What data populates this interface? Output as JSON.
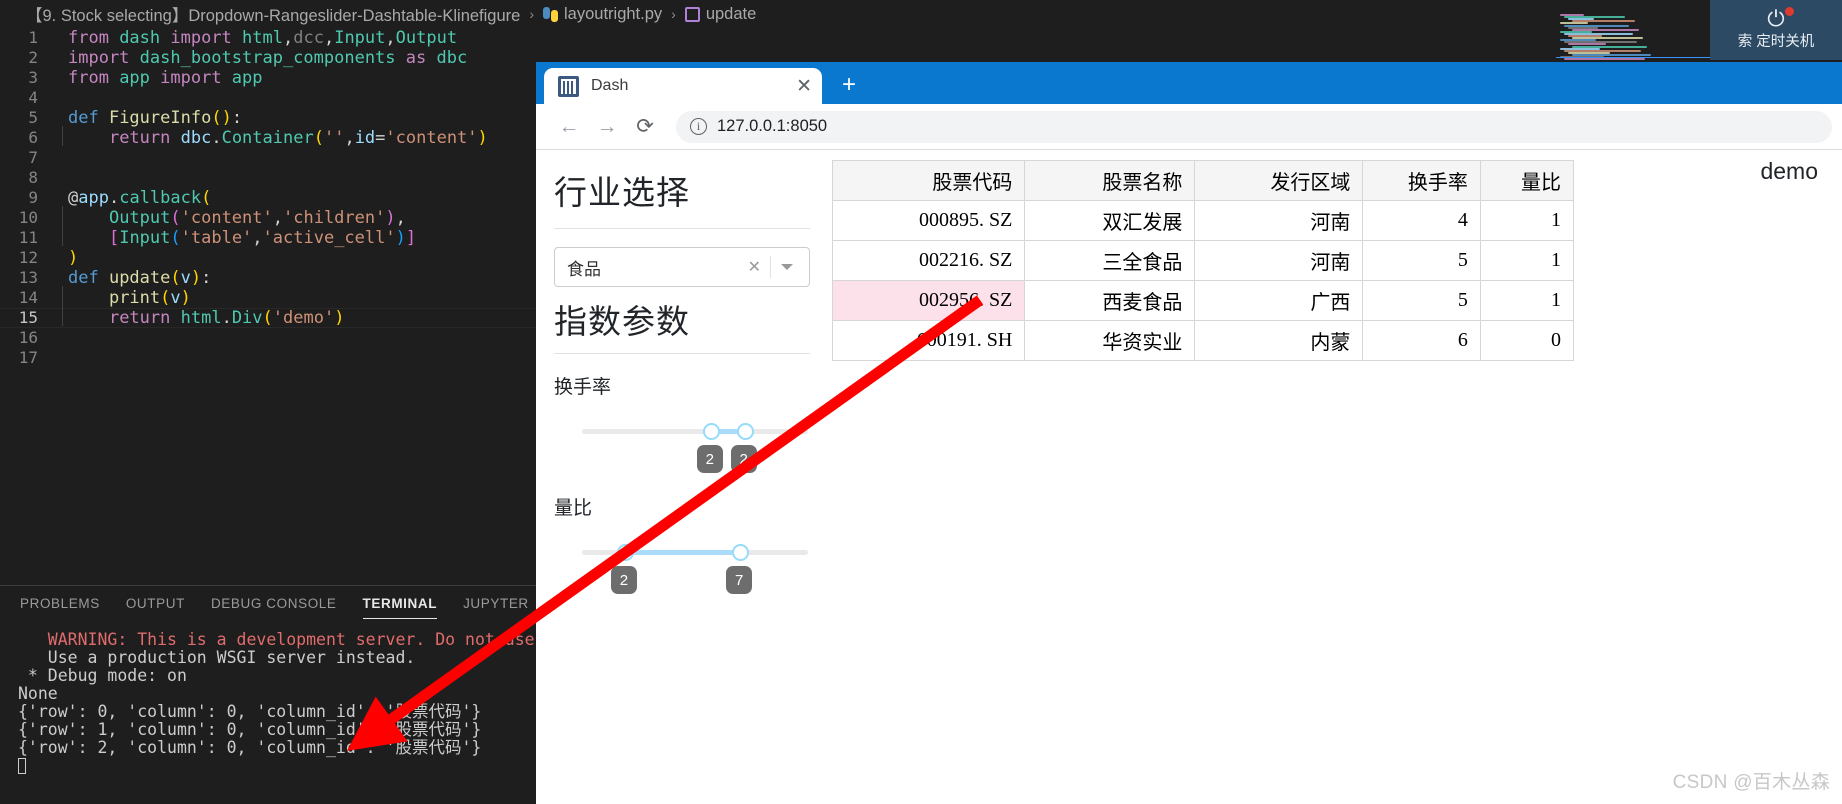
{
  "editor": {
    "breadcrumb": {
      "project": "【9. Stock selecting】Dropdown-Rangeslider-Dashtable-Klinefigure",
      "file": "layoutright.py",
      "symbol": "update",
      "separator": "›"
    },
    "lines": [
      {
        "n": "1",
        "tokens": [
          {
            "t": "from ",
            "c": "kw"
          },
          {
            "t": "dash ",
            "c": "mod"
          },
          {
            "t": "import ",
            "c": "kw"
          },
          {
            "t": "html",
            "c": "mod"
          },
          {
            "t": ",",
            "c": "pun"
          },
          {
            "t": "dcc",
            "c": "dim"
          },
          {
            "t": ",",
            "c": "pun"
          },
          {
            "t": "Input",
            "c": "mod"
          },
          {
            "t": ",",
            "c": "pun"
          },
          {
            "t": "Output",
            "c": "mod"
          }
        ]
      },
      {
        "n": "2",
        "tokens": [
          {
            "t": "import ",
            "c": "kw"
          },
          {
            "t": "dash_bootstrap_components ",
            "c": "mod"
          },
          {
            "t": "as ",
            "c": "kw"
          },
          {
            "t": "dbc",
            "c": "mod"
          }
        ]
      },
      {
        "n": "3",
        "tokens": [
          {
            "t": "from ",
            "c": "kw"
          },
          {
            "t": "app ",
            "c": "mod"
          },
          {
            "t": "import ",
            "c": "kw"
          },
          {
            "t": "app",
            "c": "mod"
          }
        ]
      },
      {
        "n": "4",
        "tokens": []
      },
      {
        "n": "5",
        "tokens": [
          {
            "t": "def ",
            "c": "kw2"
          },
          {
            "t": "FigureInfo",
            "c": "fn"
          },
          {
            "t": "(",
            "c": "br1"
          },
          {
            "t": ")",
            "c": "br1"
          },
          {
            "t": ":",
            "c": "pun"
          }
        ]
      },
      {
        "n": "6",
        "indent": true,
        "tokens": [
          {
            "t": "    ",
            "c": "pun"
          },
          {
            "t": "return ",
            "c": "kw"
          },
          {
            "t": "dbc",
            "c": "var"
          },
          {
            "t": ".",
            "c": "pun"
          },
          {
            "t": "Container",
            "c": "dec"
          },
          {
            "t": "(",
            "c": "br1"
          },
          {
            "t": "''",
            "c": "str"
          },
          {
            "t": ",",
            "c": "pun"
          },
          {
            "t": "id",
            "c": "var"
          },
          {
            "t": "=",
            "c": "pun"
          },
          {
            "t": "'content'",
            "c": "str"
          },
          {
            "t": ")",
            "c": "br1"
          }
        ]
      },
      {
        "n": "7",
        "tokens": []
      },
      {
        "n": "8",
        "tokens": []
      },
      {
        "n": "9",
        "tokens": [
          {
            "t": "@",
            "c": "pun"
          },
          {
            "t": "app",
            "c": "var"
          },
          {
            "t": ".",
            "c": "pun"
          },
          {
            "t": "callback",
            "c": "dec"
          },
          {
            "t": "(",
            "c": "br1"
          }
        ]
      },
      {
        "n": "10",
        "indent": true,
        "tokens": [
          {
            "t": "    ",
            "c": "pun"
          },
          {
            "t": "Output",
            "c": "dec"
          },
          {
            "t": "(",
            "c": "br2"
          },
          {
            "t": "'content'",
            "c": "str"
          },
          {
            "t": ",",
            "c": "pun"
          },
          {
            "t": "'children'",
            "c": "str"
          },
          {
            "t": ")",
            "c": "br2"
          },
          {
            "t": ",",
            "c": "pun"
          }
        ]
      },
      {
        "n": "11",
        "indent": true,
        "tokens": [
          {
            "t": "    ",
            "c": "pun"
          },
          {
            "t": "[",
            "c": "br2"
          },
          {
            "t": "Input",
            "c": "dec"
          },
          {
            "t": "(",
            "c": "br3"
          },
          {
            "t": "'table'",
            "c": "str"
          },
          {
            "t": ",",
            "c": "pun"
          },
          {
            "t": "'active_cell'",
            "c": "str"
          },
          {
            "t": ")",
            "c": "br3"
          },
          {
            "t": "]",
            "c": "br2"
          }
        ]
      },
      {
        "n": "12",
        "tokens": [
          {
            "t": ")",
            "c": "br1"
          }
        ]
      },
      {
        "n": "13",
        "tokens": [
          {
            "t": "def ",
            "c": "kw2"
          },
          {
            "t": "update",
            "c": "fn"
          },
          {
            "t": "(",
            "c": "br1"
          },
          {
            "t": "v",
            "c": "var"
          },
          {
            "t": ")",
            "c": "br1"
          },
          {
            "t": ":",
            "c": "pun"
          }
        ]
      },
      {
        "n": "14",
        "indent": true,
        "tokens": [
          {
            "t": "    ",
            "c": "pun"
          },
          {
            "t": "print",
            "c": "fn"
          },
          {
            "t": "(",
            "c": "br1"
          },
          {
            "t": "v",
            "c": "var"
          },
          {
            "t": ")",
            "c": "br1"
          }
        ]
      },
      {
        "n": "15",
        "indent": true,
        "active": true,
        "tokens": [
          {
            "t": "    ",
            "c": "pun"
          },
          {
            "t": "return ",
            "c": "kw"
          },
          {
            "t": "html",
            "c": "mod"
          },
          {
            "t": ".",
            "c": "pun"
          },
          {
            "t": "Div",
            "c": "dec"
          },
          {
            "t": "(",
            "c": "br1"
          },
          {
            "t": "'demo'",
            "c": "str"
          },
          {
            "t": ")",
            "c": "br1"
          }
        ]
      },
      {
        "n": "16",
        "tokens": []
      },
      {
        "n": "17",
        "tokens": []
      }
    ]
  },
  "panel": {
    "tabs": [
      {
        "label": "PROBLEMS",
        "active": false
      },
      {
        "label": "OUTPUT",
        "active": false
      },
      {
        "label": "DEBUG CONSOLE",
        "active": false
      },
      {
        "label": "TERMINAL",
        "active": true
      },
      {
        "label": "JUPYTER",
        "active": false
      }
    ],
    "terminal_lines": [
      {
        "text": "   WARNING: This is a development server. Do not use it in a produc",
        "warn": true
      },
      {
        "text": "   Use a production WSGI server instead.",
        "warn": false
      },
      {
        "text": " * Debug mode: on",
        "warn": false
      },
      {
        "text": "None",
        "warn": false
      },
      {
        "text": "{'row': 0, 'column': 0, 'column_id': '股票代码'}",
        "warn": false
      },
      {
        "text": "{'row': 1, 'column': 0, 'column_id': '股票代码'}",
        "warn": false
      },
      {
        "text": "{'row': 2, 'column': 0, 'column_id': '股票代码'}",
        "warn": false
      }
    ]
  },
  "shutdown_widget": {
    "label": "定时关机",
    "partial_prefix": "索",
    "power_glyph": "⏻"
  },
  "browser": {
    "tab": {
      "title": "Dash",
      "close_glyph": "✕"
    },
    "new_tab_glyph": "+",
    "toolbar": {
      "back_glyph": "←",
      "forward_glyph": "→",
      "reload_glyph": "⟳",
      "info_glyph": "i",
      "url": "127.0.0.1:8050"
    }
  },
  "app": {
    "industry_section_title": "行业选择",
    "dropdown": {
      "value": "食品",
      "clear_glyph": "✕",
      "caret": "caret-down"
    },
    "params_section_title": "指数参数",
    "sliders": [
      {
        "label": "换手率",
        "low_value": "2",
        "high_value": "2",
        "low_pct": 57,
        "high_pct": 72
      },
      {
        "label": "量比",
        "low_value": "2",
        "high_value": "7",
        "low_pct": 19,
        "high_pct": 70
      }
    ],
    "table": {
      "columns": [
        "股票代码",
        "股票名称",
        "发行区域",
        "换手率",
        "量比"
      ],
      "rows": [
        {
          "cells": [
            "000895. SZ",
            "双汇发展",
            "河南",
            "4",
            "1"
          ],
          "active_col": -1
        },
        {
          "cells": [
            "002216. SZ",
            "三全食品",
            "河南",
            "5",
            "1"
          ],
          "active_col": -1
        },
        {
          "cells": [
            "002956. SZ",
            "西麦食品",
            "广西",
            "5",
            "1"
          ],
          "active_col": 0
        },
        {
          "cells": [
            "600191. SH",
            "华资实业",
            "内蒙",
            "6",
            "0"
          ],
          "active_col": -1
        }
      ]
    },
    "callback_output": "demo"
  },
  "watermark": "CSDN @百木丛森",
  "colors": {
    "browser_chrome": "#0b78d0",
    "active_cell_border": "#f23f8e",
    "active_cell_fill": "#fce1ea",
    "slider_fill": "#abdcfb",
    "arrow": "#ff0000",
    "terminal_warn": "#e06c6c"
  }
}
